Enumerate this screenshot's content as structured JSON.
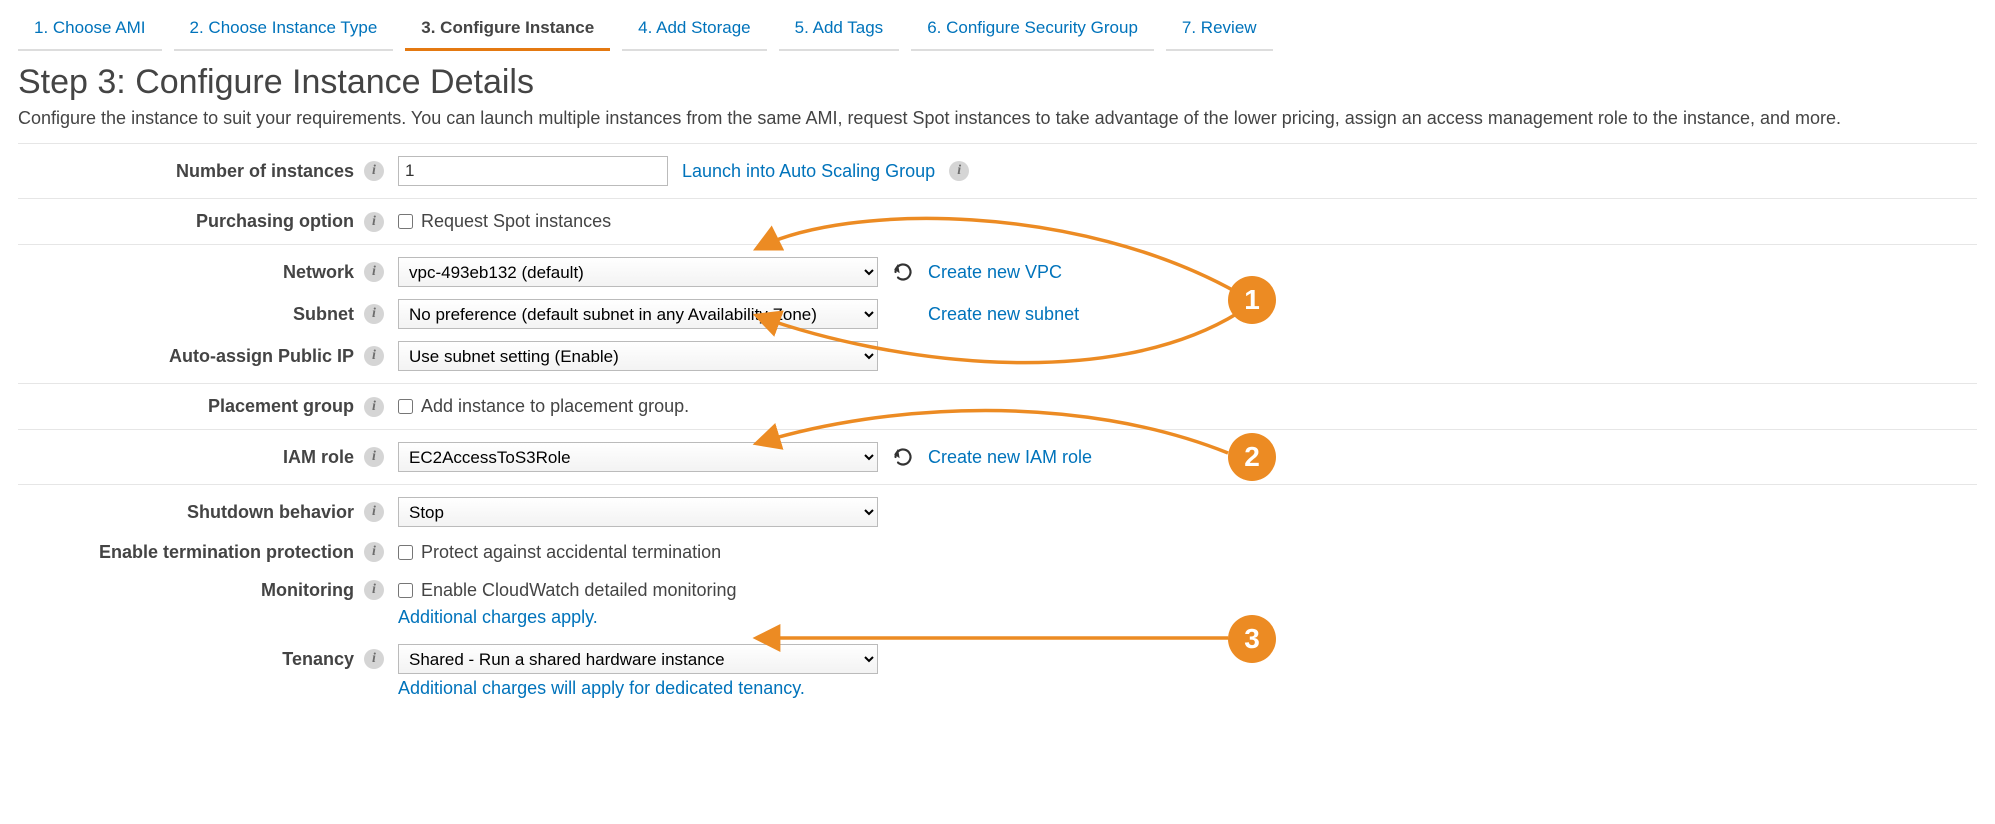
{
  "wizard_tabs": [
    "1. Choose AMI",
    "2. Choose Instance Type",
    "3. Configure Instance",
    "4. Add Storage",
    "5. Add Tags",
    "6. Configure Security Group",
    "7. Review"
  ],
  "wizard_active_index": 2,
  "heading": "Step 3: Configure Instance Details",
  "subheading": "Configure the instance to suit your requirements. You can launch multiple instances from the same AMI, request Spot instances to take advantage of the lower pricing, assign an access management role to the instance, and more.",
  "labels": {
    "instances": "Number of instances",
    "purchasing": "Purchasing option",
    "network": "Network",
    "subnet": "Subnet",
    "autoip": "Auto-assign Public IP",
    "placement": "Placement group",
    "iam": "IAM role",
    "shutdown": "Shutdown behavior",
    "termprot": "Enable termination protection",
    "monitoring": "Monitoring",
    "tenancy": "Tenancy"
  },
  "values": {
    "instances": "1",
    "network": "vpc-493eb132 (default)",
    "subnet": "No preference (default subnet in any Availability Zone)",
    "autoip": "Use subnet setting (Enable)",
    "iam": "EC2AccessToS3Role",
    "shutdown": "Stop",
    "tenancy": "Shared - Run a shared hardware instance"
  },
  "checkbox_labels": {
    "spot": "Request Spot instances",
    "placement": "Add instance to placement group.",
    "termprot": "Protect against accidental termination",
    "monitoring": "Enable CloudWatch detailed monitoring"
  },
  "links": {
    "asg": "Launch into Auto Scaling Group",
    "new_vpc": "Create new VPC",
    "new_subnet": "Create new subnet",
    "new_iam": "Create new IAM role"
  },
  "notes": {
    "monitoring": "Additional charges apply.",
    "tenancy": "Additional charges will apply for dedicated tenancy."
  },
  "annotations": {
    "1": "1",
    "2": "2",
    "3": "3"
  }
}
